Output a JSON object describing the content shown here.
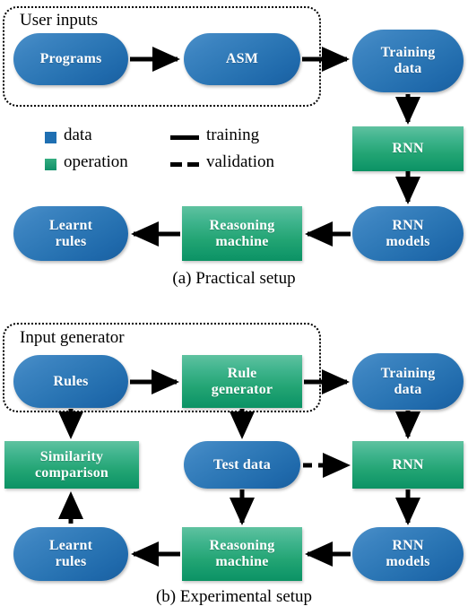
{
  "figure": {
    "panel_a": {
      "group_label": "User inputs",
      "caption": "(a) Practical setup",
      "nodes": [
        {
          "id": "programs",
          "label": "Programs",
          "kind": "data"
        },
        {
          "id": "asm",
          "label": "ASM",
          "kind": "data"
        },
        {
          "id": "training_data",
          "label": "Training\ndata",
          "line1": "Training",
          "line2": "data",
          "kind": "data"
        },
        {
          "id": "rnn",
          "label": "RNN",
          "kind": "operation"
        },
        {
          "id": "rnn_models",
          "label": "RNN\nmodels",
          "line1": "RNN",
          "line2": "models",
          "kind": "data"
        },
        {
          "id": "reasoning_machine",
          "label": "Reasoning\nmachine",
          "line1": "Reasoning",
          "line2": "machine",
          "kind": "operation"
        },
        {
          "id": "learnt_rules",
          "label": "Learnt\nrules",
          "line1": "Learnt",
          "line2": "rules",
          "kind": "data"
        }
      ],
      "edges": [
        {
          "from": "programs",
          "to": "asm",
          "style": "training"
        },
        {
          "from": "asm",
          "to": "training_data",
          "style": "training"
        },
        {
          "from": "training_data",
          "to": "rnn",
          "style": "training"
        },
        {
          "from": "rnn",
          "to": "rnn_models",
          "style": "training"
        },
        {
          "from": "rnn_models",
          "to": "reasoning_machine",
          "style": "training"
        },
        {
          "from": "reasoning_machine",
          "to": "learnt_rules",
          "style": "training"
        }
      ]
    },
    "panel_b": {
      "group_label": "Input generator",
      "caption": "(b) Experimental setup",
      "nodes": [
        {
          "id": "rules",
          "label": "Rules",
          "kind": "data"
        },
        {
          "id": "rule_generator",
          "label": "Rule\ngenerator",
          "line1": "Rule",
          "line2": "generator",
          "kind": "operation"
        },
        {
          "id": "training_data_b",
          "label": "Training\ndata",
          "line1": "Training",
          "line2": "data",
          "kind": "data"
        },
        {
          "id": "similarity_comparison",
          "label": "Similarity\ncomparison",
          "line1": "Similarity",
          "line2": "comparison",
          "kind": "operation"
        },
        {
          "id": "test_data",
          "label": "Test data",
          "kind": "data"
        },
        {
          "id": "rnn_b",
          "label": "RNN",
          "kind": "operation"
        },
        {
          "id": "learnt_rules_b",
          "label": "Learnt\nrules",
          "line1": "Learnt",
          "line2": "rules",
          "kind": "data"
        },
        {
          "id": "reasoning_machine_b",
          "label": "Reasoning\nmachine",
          "line1": "Reasoning",
          "line2": "machine",
          "kind": "operation"
        },
        {
          "id": "rnn_models_b",
          "label": "RNN\nmodels",
          "line1": "RNN",
          "line2": "models",
          "kind": "data"
        }
      ],
      "edges": [
        {
          "from": "rules",
          "to": "rule_generator",
          "style": "training"
        },
        {
          "from": "rule_generator",
          "to": "training_data_b",
          "style": "training"
        },
        {
          "from": "rules",
          "to": "similarity_comparison",
          "style": "validation"
        },
        {
          "from": "rule_generator",
          "to": "test_data",
          "style": "validation"
        },
        {
          "from": "training_data_b",
          "to": "rnn_b",
          "style": "training"
        },
        {
          "from": "test_data",
          "to": "rnn_b",
          "style": "validation"
        },
        {
          "from": "rnn_b",
          "to": "rnn_models_b",
          "style": "training"
        },
        {
          "from": "rnn_models_b",
          "to": "reasoning_machine_b",
          "style": "training"
        },
        {
          "from": "test_data",
          "to": "reasoning_machine_b",
          "style": "validation"
        },
        {
          "from": "reasoning_machine_b",
          "to": "learnt_rules_b",
          "style": "training"
        },
        {
          "from": "learnt_rules_b",
          "to": "similarity_comparison",
          "style": "validation"
        }
      ]
    },
    "legend": {
      "items": [
        {
          "id": "data",
          "label": "data",
          "swatch": "blue-square-icon",
          "color": "#1f6fb2"
        },
        {
          "id": "operation",
          "label": "operation",
          "swatch": "green-square-icon",
          "color": "#22a473"
        },
        {
          "id": "training",
          "label": "training",
          "swatch": "solid-line-icon",
          "color": "#000000"
        },
        {
          "id": "validation",
          "label": "validation",
          "swatch": "dashed-line-icon",
          "color": "#000000"
        }
      ]
    }
  }
}
